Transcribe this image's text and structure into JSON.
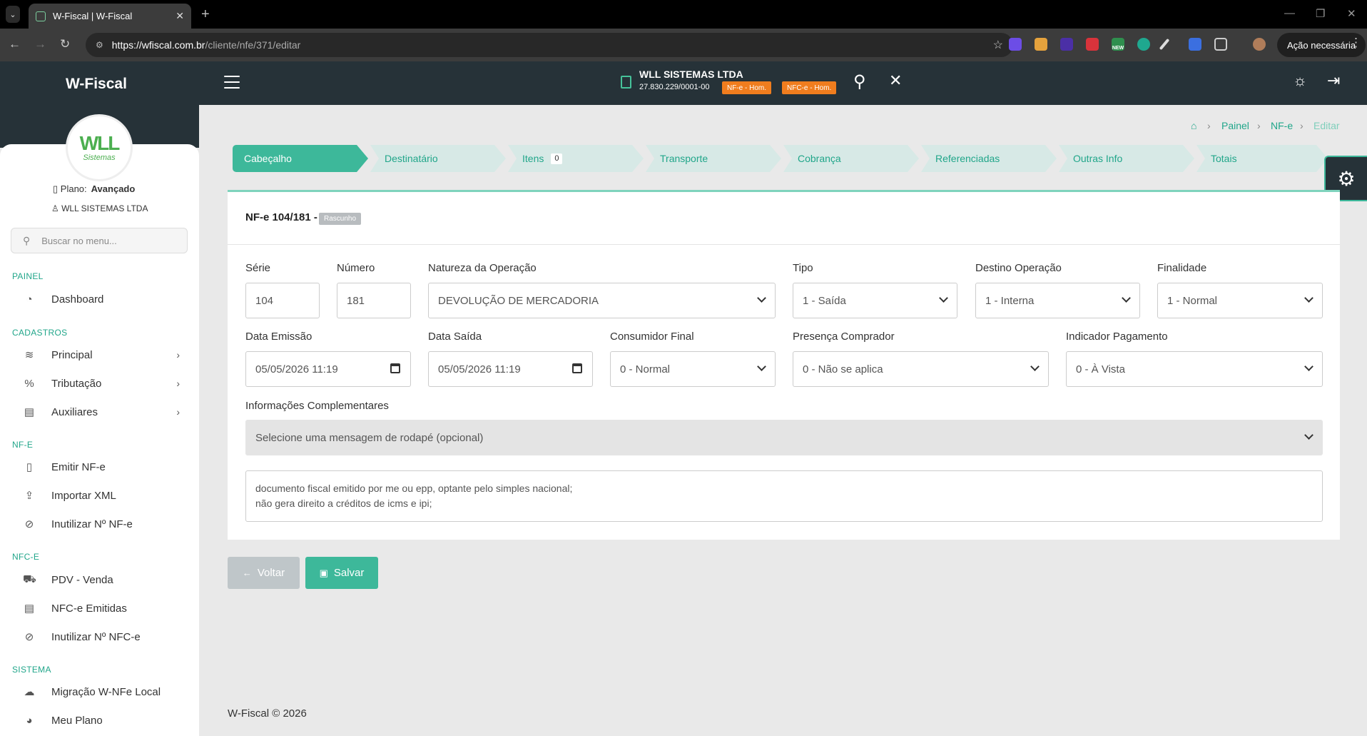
{
  "browser": {
    "tab_title": "W-Fiscal | W-Fiscal",
    "url_host": "https://wfiscal.com.br",
    "url_path": "/cliente/nfe/371/editar",
    "action_button": "Ação necessária",
    "ext_badge": "NEW"
  },
  "header": {
    "brand": "W-Fiscal",
    "company_name": "WLL SISTEMAS LTDA",
    "company_cnpj": "27.830.229/0001-00",
    "badge_nfe": "NF-e - Hom.",
    "badge_nfce": "NFC-e - Hom."
  },
  "sidebar": {
    "logo_main": "WLL",
    "logo_sub": "Sistemas",
    "plan_label": "Plano:",
    "plan_value": "Avançado",
    "user": "WLL SISTEMAS LTDA",
    "search_placeholder": "Buscar no menu...",
    "sections": {
      "painel": "PAINEL",
      "cadastros": "CADASTROS",
      "nfe": "NF-E",
      "nfce": "NFC-E",
      "sistema": "SISTEMA"
    },
    "items": {
      "dashboard": "Dashboard",
      "principal": "Principal",
      "tributacao": "Tributação",
      "auxiliares": "Auxiliares",
      "emitir": "Emitir NF-e",
      "importar": "Importar XML",
      "inutilizar_nfe": "Inutilizar Nº NF-e",
      "pdv": "PDV - Venda",
      "nfce_emitidas": "NFC-e Emitidas",
      "inutilizar_nfce": "Inutilizar Nº NFC-e",
      "migracao": "Migração W-NFe Local",
      "plano": "Meu Plano"
    }
  },
  "breadcrumb": [
    "Painel",
    "NF-e",
    "Editar"
  ],
  "steps": [
    "Cabeçalho",
    "Destinatário",
    "Itens",
    "Transporte",
    "Cobrança",
    "Referenciadas",
    "Outras Info",
    "Totais"
  ],
  "items_count": "0",
  "form": {
    "title": "NF-e 104/181 -",
    "status": "Rascunho",
    "serie_label": "Série",
    "serie": "104",
    "numero_label": "Número",
    "numero": "181",
    "natureza_label": "Natureza da Operação",
    "natureza": "DEVOLUÇÃO DE MERCADORIA",
    "tipo_label": "Tipo",
    "tipo": "1 - Saída",
    "destino_label": "Destino Operação",
    "destino": "1 - Interna",
    "finalidade_label": "Finalidade",
    "finalidade": "1 - Normal",
    "emissao_label": "Data Emissão",
    "emissao": "05/05/2026 11:19",
    "saida_label": "Data Saída",
    "saida": "05/05/2026 11:19",
    "consumidor_label": "Consumidor Final",
    "consumidor": "0 - Normal",
    "presenca_label": "Presença Comprador",
    "presenca": "0 - Não se aplica",
    "pagamento_label": "Indicador Pagamento",
    "pagamento": "0 - À Vista",
    "info_label": "Informações Complementares",
    "info_select": "Selecione uma mensagem de rodapé (opcional)",
    "info_text_1": "documento fiscal emitido por me ou epp, optante pelo simples nacional;",
    "info_text_2": "não gera direito a créditos de icms e ipi;"
  },
  "buttons": {
    "back": "Voltar",
    "save": "Salvar"
  },
  "footer": "W-Fiscal © 2026",
  "colors": {
    "accent": "#3db89a",
    "dark": "#263238",
    "badge": "#f07d1e"
  }
}
